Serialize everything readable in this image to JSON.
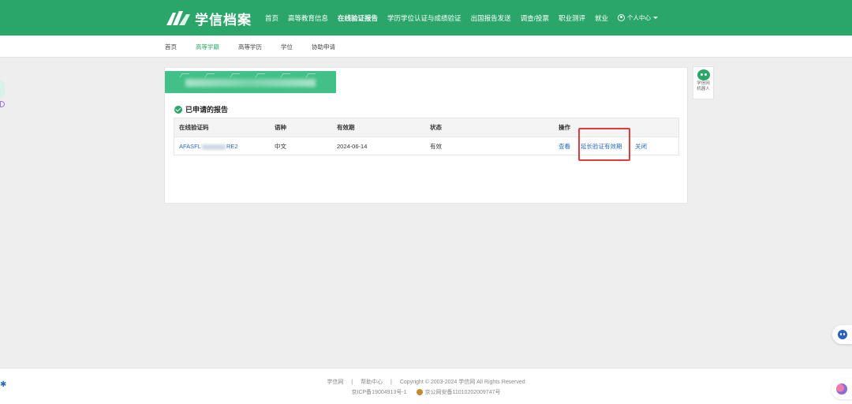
{
  "header": {
    "logo_text": "学信档案",
    "nav": [
      {
        "label": "首页",
        "active": false
      },
      {
        "label": "高等教育信息",
        "active": false
      },
      {
        "label": "在线验证报告",
        "active": true
      },
      {
        "label": "学历学位认证与成绩验证",
        "active": false
      },
      {
        "label": "出国报告发送",
        "active": false
      },
      {
        "label": "调查/投票",
        "active": false
      },
      {
        "label": "职业测评",
        "active": false
      },
      {
        "label": "就业",
        "active": false
      }
    ],
    "user_menu_label": "个人中心"
  },
  "subnav": {
    "items": [
      "首页",
      "高等学籍",
      "高等学历",
      "学位",
      "协助申请"
    ],
    "active": "高等学籍"
  },
  "report": {
    "section_title": "已申请的报告",
    "columns": [
      "在线验证码",
      "语种",
      "有效期",
      "状态",
      "操作"
    ],
    "rows": [
      {
        "code_prefix": "AFASFL",
        "code_suffix": "RE2",
        "language": "中文",
        "expiry": "2024-06-14",
        "status": "有效",
        "actions": [
          "查看",
          "延长验证有效期",
          "关闭"
        ]
      }
    ]
  },
  "robot": {
    "label_line1": "学信网",
    "label_line2": "机器人"
  },
  "footer": {
    "links": [
      "学信网",
      "|",
      "帮助中心",
      "|",
      "Copyright © 2003-2024 学信网 All Rights Reserved"
    ],
    "icp": "京ICP备19004913号-1",
    "police": "京公网安备11010202009747号"
  },
  "colors": {
    "brand_green": "#2ba66a",
    "link_blue": "#2a6bc2",
    "highlight_red": "#e23b3b"
  }
}
